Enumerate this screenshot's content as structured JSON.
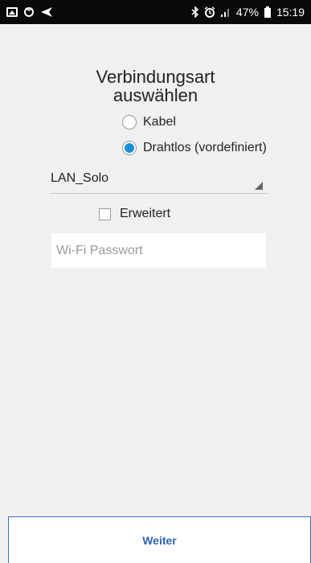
{
  "status_bar": {
    "left_icons": [
      "gallery-icon",
      "network-sync-icon",
      "navigation-icon"
    ],
    "right_icons": [
      "bluetooth-icon",
      "alarm-icon",
      "signal-icon",
      "battery-icon"
    ],
    "battery": "47%",
    "time": "15:19"
  },
  "page": {
    "title_line1": "Verbindungsart",
    "title_line2": "auswählen"
  },
  "connection": {
    "option_cable": "Kabel",
    "option_wireless": "Drahtlos (vordefiniert)",
    "selected": "wireless"
  },
  "network_select": {
    "value": "LAN_Solo"
  },
  "advanced": {
    "label": "Erweitert",
    "checked": false
  },
  "password": {
    "placeholder": "Wi-Fi Passwort",
    "value": ""
  },
  "footer": {
    "next_label": "Weiter"
  },
  "colors": {
    "accent": "#1a8fd8",
    "button_text": "#2f64b4",
    "background": "#f0f0f0"
  }
}
